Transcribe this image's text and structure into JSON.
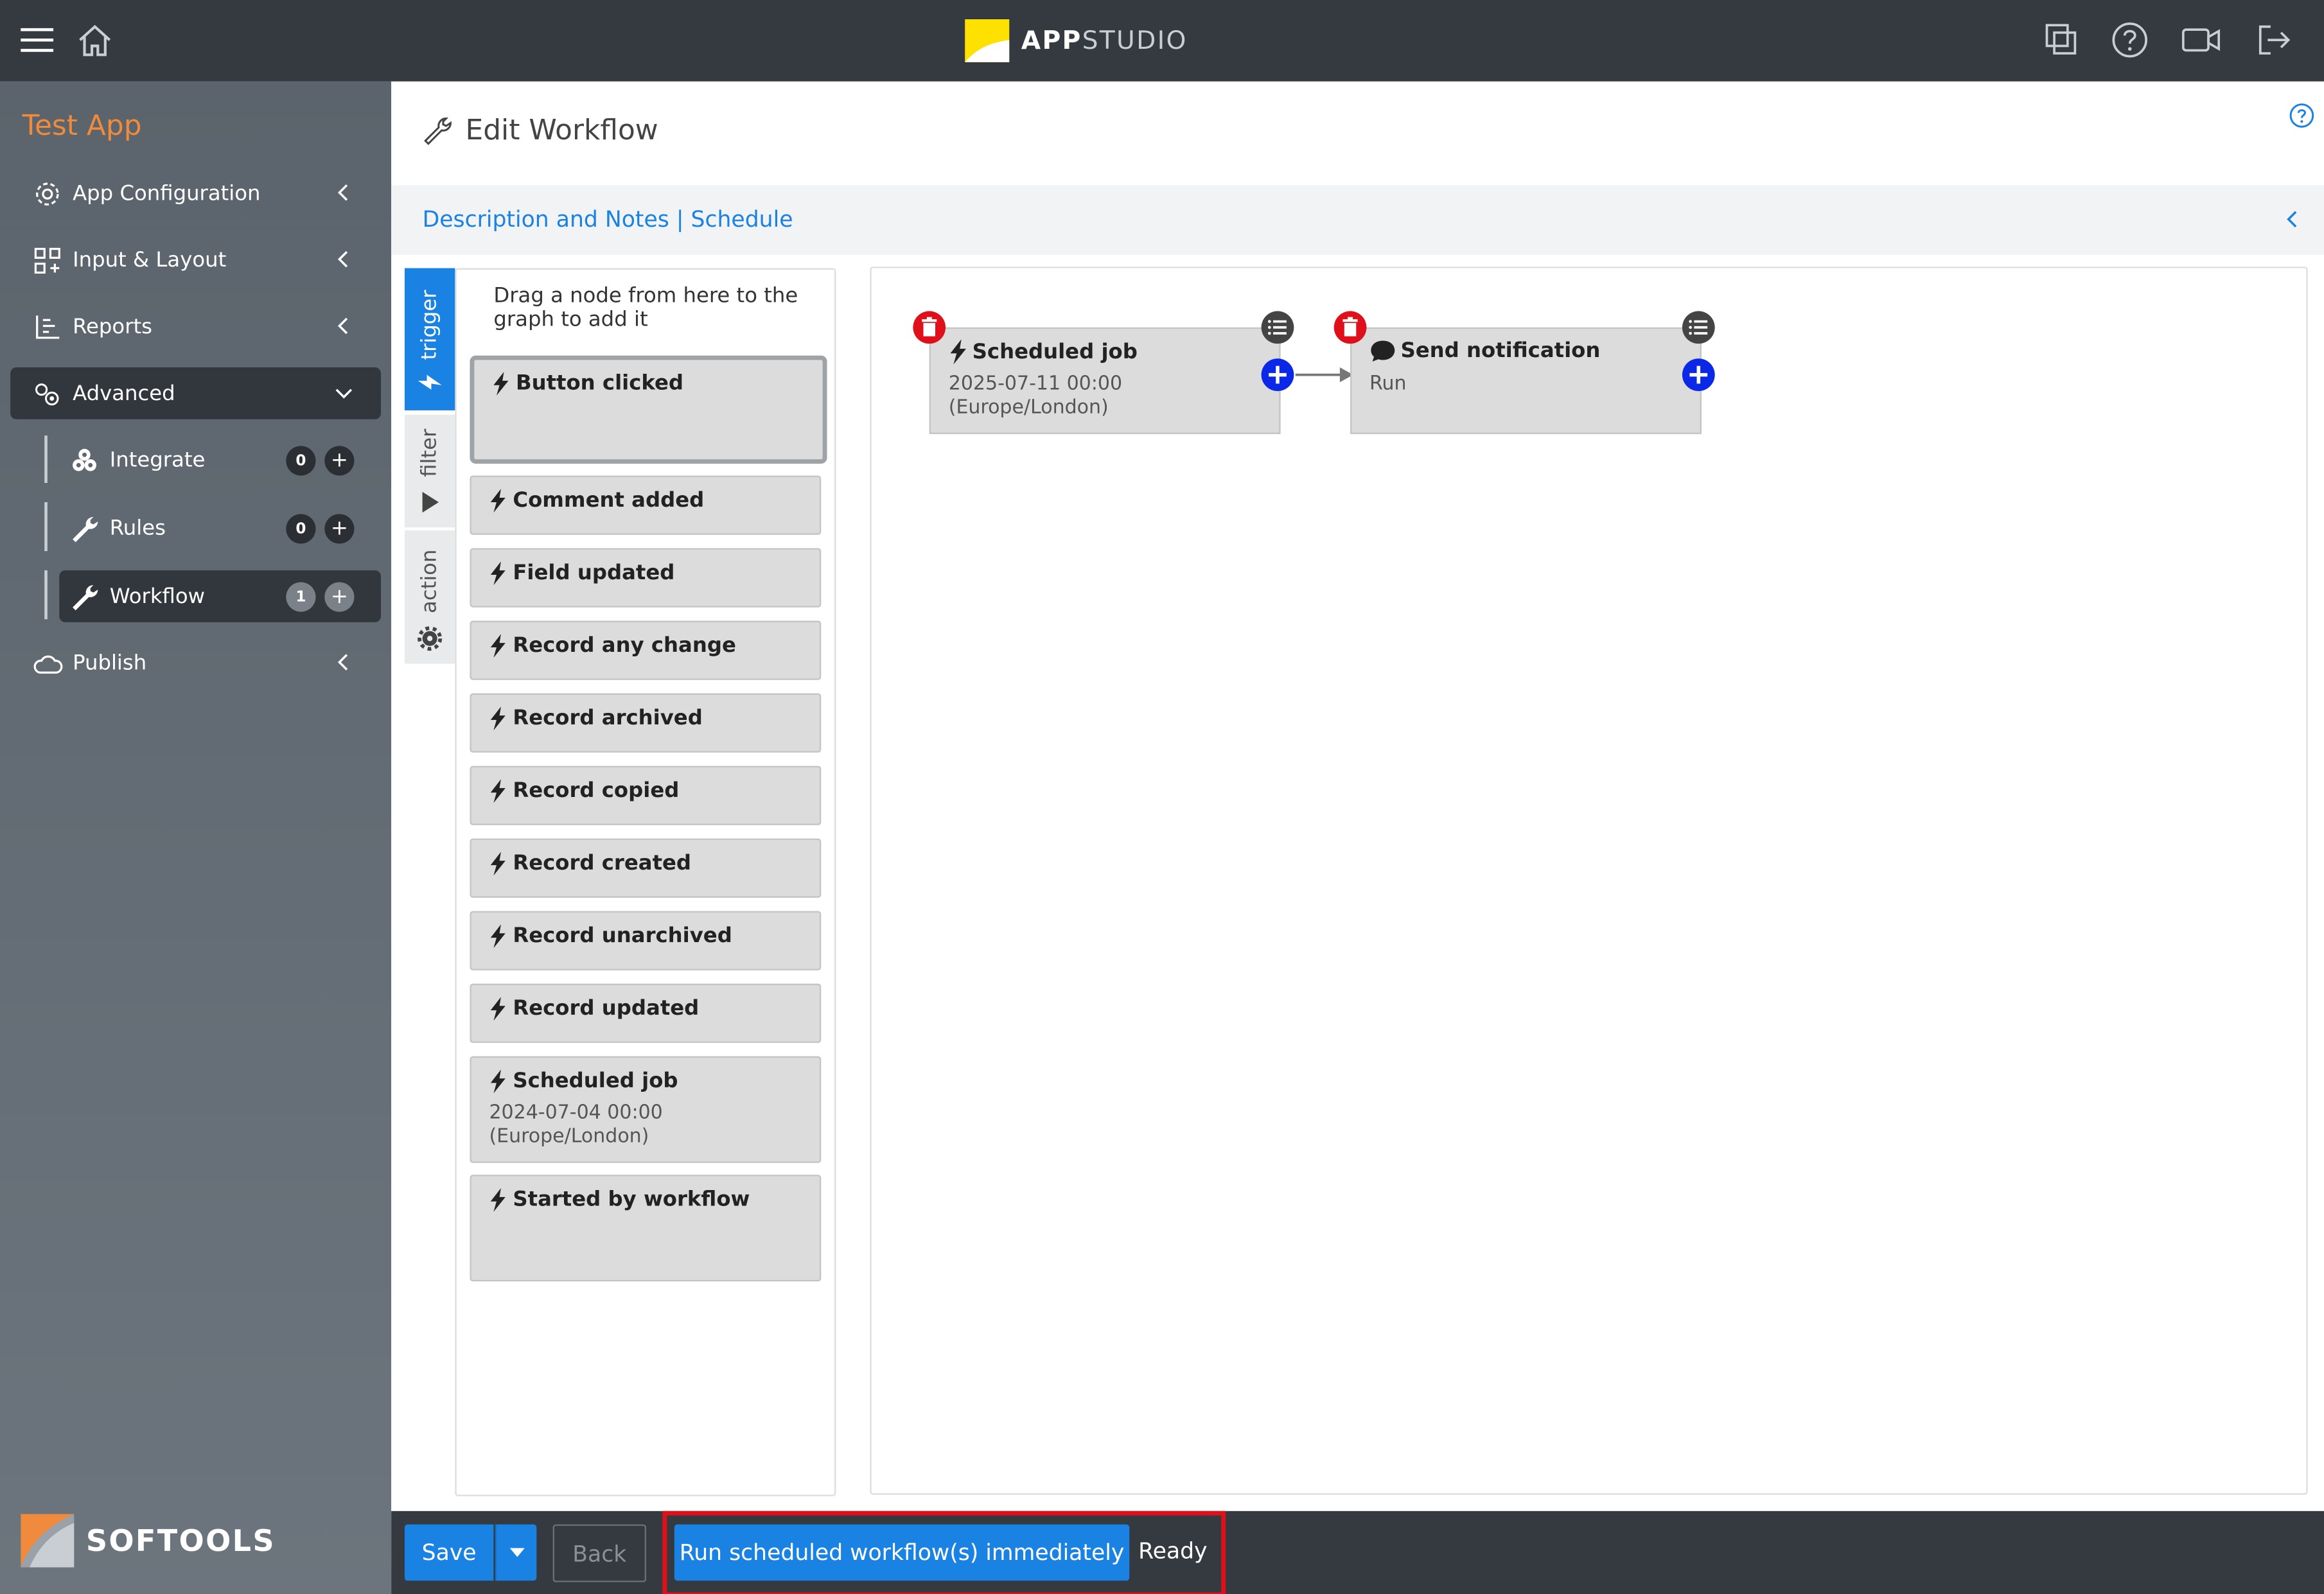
{
  "header": {
    "brand_bold": "APP",
    "brand_light": "STUDIO",
    "icons": [
      "menu-icon",
      "home-icon",
      "copy-icon",
      "help-icon",
      "video-icon",
      "logout-icon"
    ]
  },
  "sidebar": {
    "app_name": "Test App",
    "items": [
      {
        "label": "App Configuration"
      },
      {
        "label": "Input & Layout"
      },
      {
        "label": "Reports"
      },
      {
        "label": "Advanced"
      },
      {
        "label": "Publish"
      }
    ],
    "sub_items": [
      {
        "label": "Integrate",
        "count": "0"
      },
      {
        "label": "Rules",
        "count": "0"
      },
      {
        "label": "Workflow",
        "count": "1"
      }
    ],
    "footer_brand": "SOFTOOLS"
  },
  "main": {
    "title": "Edit Workflow",
    "tabs_links": "Description and Notes | Schedule",
    "vertical_tabs": [
      {
        "label": "trigger"
      },
      {
        "label": "filter"
      },
      {
        "label": "action"
      }
    ],
    "palette_hint": "Drag a node from here to the graph to add it",
    "palette_nodes": [
      {
        "title": "Button clicked",
        "sub": ""
      },
      {
        "title": "Comment added",
        "sub": ""
      },
      {
        "title": "Field updated",
        "sub": ""
      },
      {
        "title": "Record any change",
        "sub": ""
      },
      {
        "title": "Record archived",
        "sub": ""
      },
      {
        "title": "Record copied",
        "sub": ""
      },
      {
        "title": "Record created",
        "sub": ""
      },
      {
        "title": "Record unarchived",
        "sub": ""
      },
      {
        "title": "Record updated",
        "sub": ""
      },
      {
        "title": "Scheduled job",
        "sub": "2024-07-04 00:00\n(Europe/London)"
      },
      {
        "title": "Started by workflow",
        "sub": ""
      }
    ],
    "graph_nodes": [
      {
        "title": "Scheduled job",
        "line1": "2025-07-11 00:00",
        "line2": "(Europe/London)"
      },
      {
        "title": "Send notification",
        "line1": "Run",
        "line2": ""
      }
    ]
  },
  "footer": {
    "save_label": "Save",
    "back_label": "Back",
    "run_label": "Run scheduled workflow(s) immediately",
    "status": "Ready"
  },
  "colors": {
    "accent": "#1a82e2",
    "topbar": "#353a40",
    "app_name": "#f08a3c",
    "delete": "#e0101b",
    "highlight": "#e0101b"
  }
}
